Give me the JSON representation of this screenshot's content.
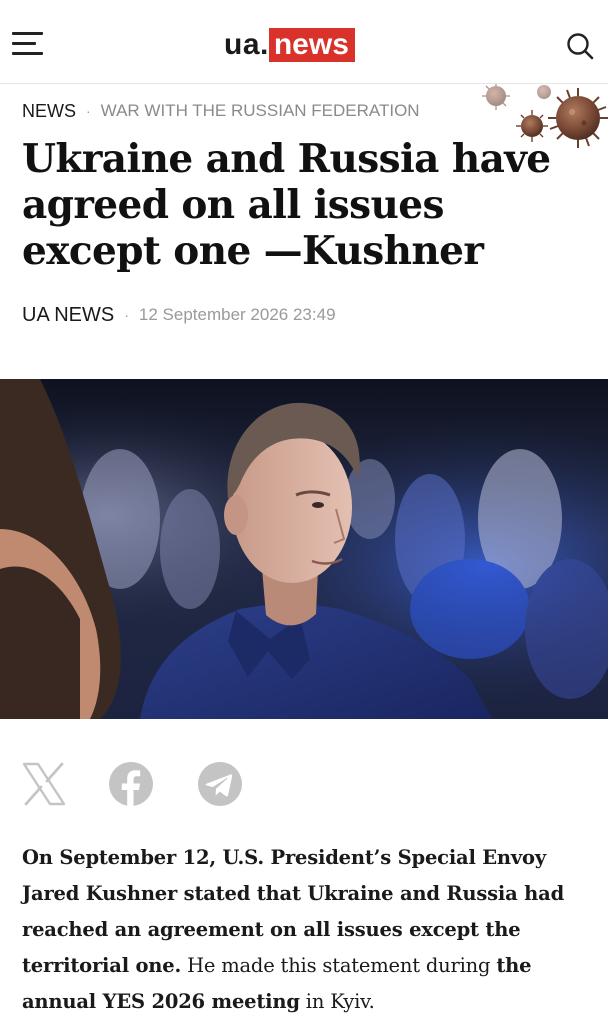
{
  "header": {
    "logo_prefix": "ua.",
    "logo_brand": "news",
    "logo_brand_color": "#d8322a",
    "menu_icon": "hamburger-menu-icon",
    "search_icon": "search-icon"
  },
  "breadcrumb": {
    "section": "NEWS",
    "separator": "·",
    "category": "WAR WITH THE RUSSIAN FEDERATION"
  },
  "article": {
    "title": "Ukraine and Russia have agreed on all issues except one —Kushner",
    "author": "UA NEWS",
    "byline_separator": "·",
    "date": "12 September 2026 23:49"
  },
  "share": {
    "buttons": [
      "x-icon",
      "facebook-icon",
      "telegram-icon"
    ],
    "icon_color": "#c4c4c4"
  },
  "body": {
    "p1_bold": "On September 12, U.S. President’s Special Envoy Jared Kushner stated that Ukraine and Russia had reached an agreement on all issues except the territorial one.",
    "p1_text1": " He made this statement during ",
    "p1_bold2": "the annual YES 2026 meeting",
    "p1_text2": " in Kyiv."
  }
}
